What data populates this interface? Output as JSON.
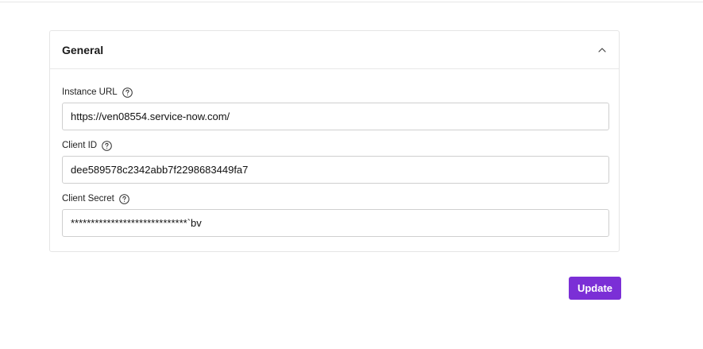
{
  "section": {
    "title": "General",
    "collapse_icon": "chevron-up-icon"
  },
  "fields": {
    "instance_url": {
      "label": "Instance URL",
      "value": "https://ven08554.service-now.com/",
      "help_icon": "question-circle-icon"
    },
    "client_id": {
      "label": "Client ID",
      "value": "dee589578c2342abb7f2298683449fa7",
      "help_icon": "question-circle-icon"
    },
    "client_secret": {
      "label": "Client Secret",
      "value": "*****************************`bv",
      "help_icon": "question-circle-icon"
    }
  },
  "actions": {
    "update_label": "Update"
  },
  "colors": {
    "accent": "#7b2fd6",
    "border": "#cfcfcf"
  }
}
